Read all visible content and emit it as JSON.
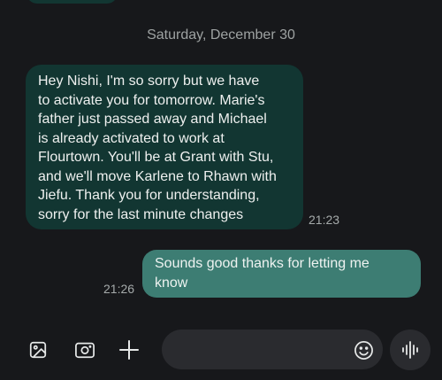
{
  "conversation": {
    "date_separator": "Saturday, December 30",
    "messages": [
      {
        "direction": "incoming",
        "text": "Hey Nishi, I'm so sorry but we have\nto activate you for tomorrow. Marie's\nfather just passed away and Michael\nis already activated to work at\nFlourtown. You'll be at Grant with Stu,\nand we'll move Karlene to Rhawn with\nJiefu. Thank you for understanding,\nsorry for the last minute changes",
        "time": "21:23"
      },
      {
        "direction": "outgoing",
        "text": "Sounds good thanks for letting me\nknow",
        "time": "21:26"
      }
    ]
  },
  "composer": {
    "input_value": "",
    "icons": [
      "gallery-icon",
      "camera-icon",
      "plus-icon",
      "emoji-icon",
      "voice-waveform-icon"
    ]
  },
  "colors": {
    "background": "#17181b",
    "incoming_bubble": "#123632",
    "outgoing_bubble": "#3d7d73",
    "input_field": "#2a2b2f"
  }
}
